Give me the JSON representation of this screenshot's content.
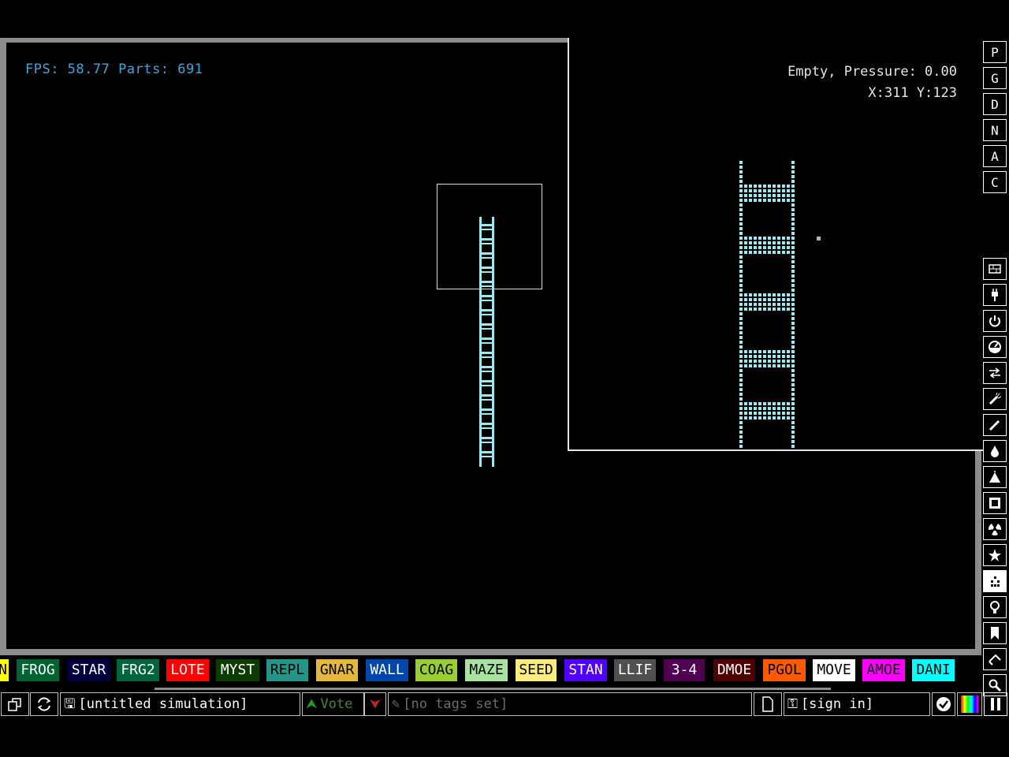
{
  "hud": {
    "fps_text": "FPS: 58.77 Parts: 691",
    "status_line": "Empty, Pressure: 0.00",
    "coords_line": "X:311 Y:123"
  },
  "right_menu": {
    "top_buttons": [
      {
        "label": "P",
        "selected": true
      },
      {
        "label": "G",
        "selected": false
      },
      {
        "label": "D",
        "selected": false
      },
      {
        "label": "N",
        "selected": true
      },
      {
        "label": "A",
        "selected": false
      },
      {
        "label": "C",
        "selected": false
      }
    ],
    "category_icons": [
      "walls-icon",
      "electronics-icon",
      "powered-icon",
      "sensors-icon",
      "force-icon",
      "explosives-icon",
      "gases-icon",
      "liquids-icon",
      "powders-icon",
      "solids-icon",
      "radioactive-icon",
      "special-icon",
      "life-icon",
      "tools-icon",
      "favorites-icon",
      "decoration-icon",
      "search-icon"
    ],
    "selected_category": "life-icon"
  },
  "elements": [
    {
      "label": "N",
      "bg": "#ffff00",
      "fg": "#000000"
    },
    {
      "label": "FROG",
      "bg": "#006432",
      "fg": "#ffffff"
    },
    {
      "label": "STAR",
      "bg": "#000040",
      "fg": "#ffffff"
    },
    {
      "label": "FRG2",
      "bg": "#00643c",
      "fg": "#ffffff"
    },
    {
      "label": "LOTE",
      "bg": "#ff0000",
      "fg": "#ffffff"
    },
    {
      "label": "MYST",
      "bg": "#0c3c00",
      "fg": "#ffffff"
    },
    {
      "label": "REPL",
      "bg": "#259588",
      "fg": "#000000"
    },
    {
      "label": "GNAR",
      "bg": "#e5b73b",
      "fg": "#000000"
    },
    {
      "label": "WALL",
      "bg": "#0047ab",
      "fg": "#ffffff"
    },
    {
      "label": "COAG",
      "bg": "#9acd32",
      "fg": "#000000"
    },
    {
      "label": "MAZE",
      "bg": "#a8e4a0",
      "fg": "#000000"
    },
    {
      "label": "SEED",
      "bg": "#fbec7d",
      "fg": "#000000"
    },
    {
      "label": "STAN",
      "bg": "#5000ff",
      "fg": "#ffffff"
    },
    {
      "label": "LLIF",
      "bg": "#505050",
      "fg": "#ffffff"
    },
    {
      "label": "3-4",
      "bg": "#500050",
      "fg": "#ffffff"
    },
    {
      "label": "DMOE",
      "bg": "#500000",
      "fg": "#ffffff"
    },
    {
      "label": "PGOL",
      "bg": "#ff5a00",
      "fg": "#000000"
    },
    {
      "label": "MOVE",
      "bg": "#ffffff",
      "fg": "#000000"
    },
    {
      "label": "AMOE",
      "bg": "#ff00ff",
      "fg": "#000000"
    },
    {
      "label": "DANI",
      "bg": "#00ffff",
      "fg": "#000000"
    }
  ],
  "bottom_bar": {
    "open_icon": "open-icon",
    "reload_icon": "reload-icon",
    "save_label": "[untitled simulation]",
    "vote_label": "Vote",
    "tags_label": "[no tags set]",
    "login_label": "[sign in]"
  }
}
